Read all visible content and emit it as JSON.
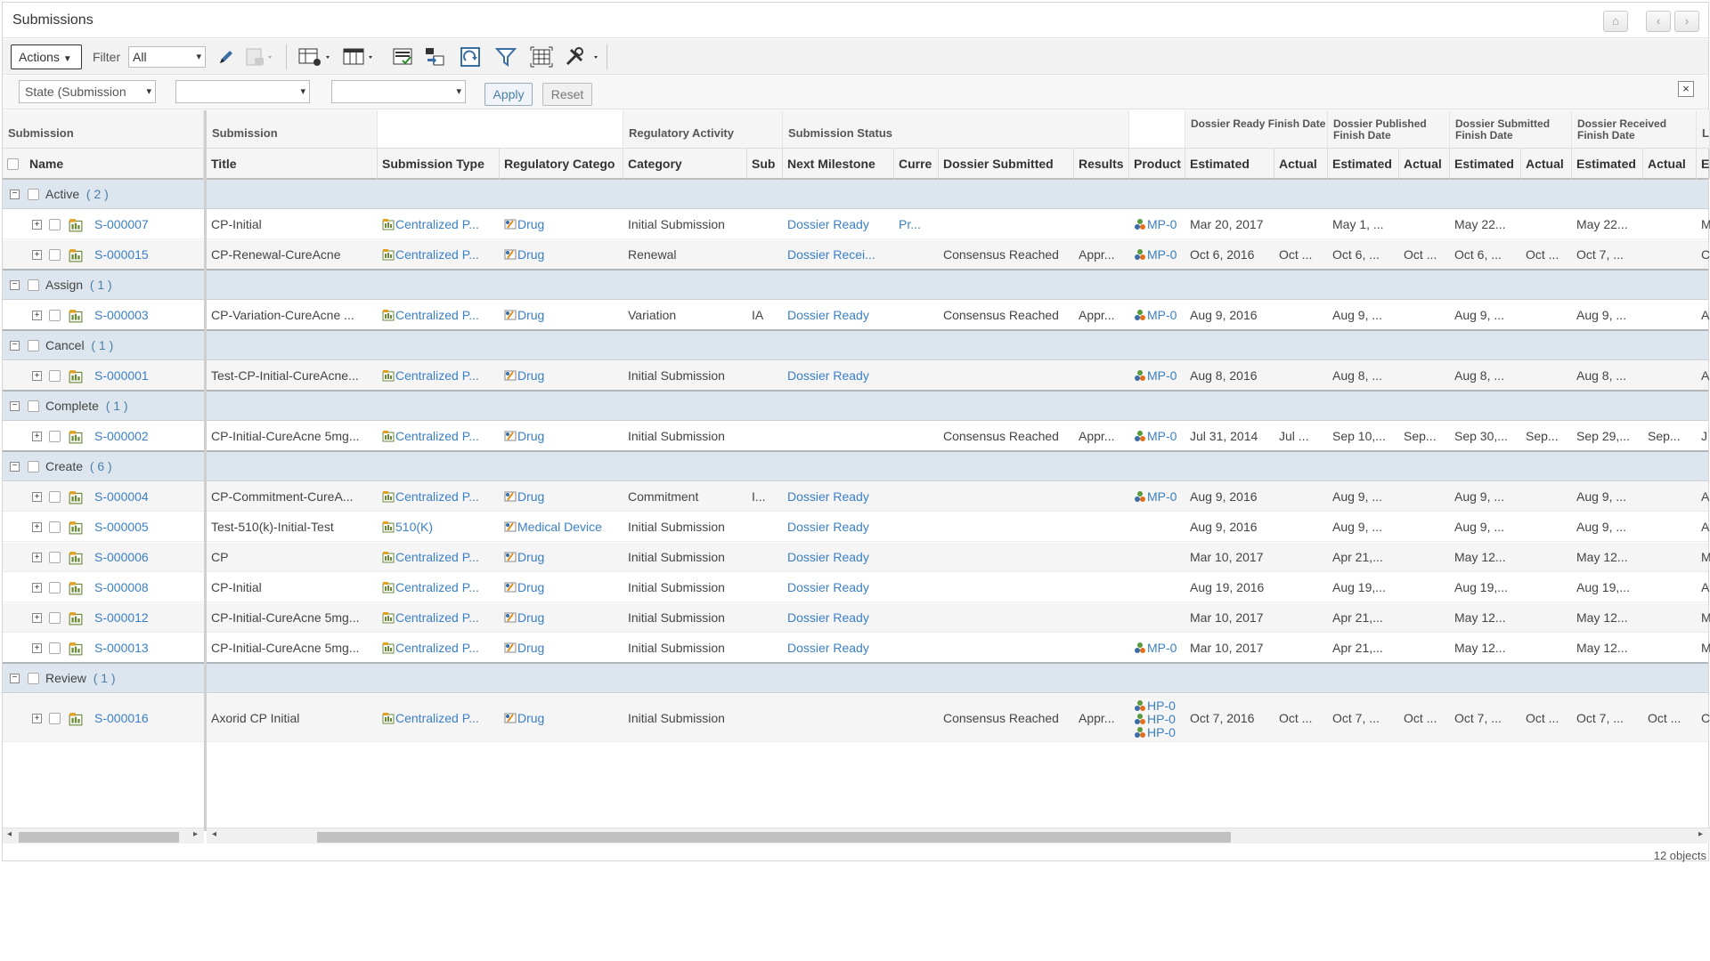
{
  "window": {
    "title": "Submissions"
  },
  "toolbar": {
    "actions_label": "Actions",
    "filter_label": "Filter",
    "filter_value": "All"
  },
  "filterbar": {
    "state_select": "State (Submission",
    "select2": "",
    "select3": "",
    "apply_label": "Apply",
    "reset_label": "Reset"
  },
  "header_groups": {
    "submission1": "Submission",
    "submission2": "Submission",
    "regulatory_activity": "Regulatory Activity",
    "submission_status": "Submission Status",
    "dossier_ready": "Dossier Ready Finish Date",
    "dossier_published": "Dossier Published Finish Date",
    "dossier_submitted": "Dossier Submitted Finish Date",
    "dossier_received": "Dossier Received Finish Date",
    "last": "L"
  },
  "columns": {
    "name": "Name",
    "title": "Title",
    "submission_type": "Submission Type",
    "regulatory_category": "Regulatory Catego",
    "category": "Category",
    "sub": "Sub",
    "next_milestone": "Next Milestone",
    "current": "Curre",
    "dossier_submitted": "Dossier Submitted",
    "results": "Results",
    "product": "Product",
    "estimated1": "Estimated",
    "actual1": "Actual",
    "estimated2": "Estimated",
    "actual2": "Actual",
    "estimated3": "Estimated",
    "actual3": "Actual",
    "estimated4": "Estimated",
    "actual4": "Actual",
    "last": "E"
  },
  "groups": [
    {
      "label": "Active",
      "count": "( 2 )"
    },
    {
      "label": "Assign",
      "count": "( 1 )"
    },
    {
      "label": "Cancel",
      "count": "( 1 )"
    },
    {
      "label": "Complete",
      "count": "( 1 )"
    },
    {
      "label": "Create",
      "count": "( 6 )"
    },
    {
      "label": "Review",
      "count": "( 1 )"
    }
  ],
  "rows": [
    {
      "name": "S-000007",
      "title": "CP-Initial",
      "type": "Centralized P...",
      "regcat": "Drug",
      "category": "Initial Submission",
      "sub": "",
      "next": "Dossier Ready",
      "current": "Pr...",
      "dsub": "",
      "results": "",
      "product": "MP-0",
      "e1": "Mar 20, 2017",
      "a1": "",
      "e2": "May 1, ...",
      "a2": "",
      "e3": "May 22...",
      "a3": "",
      "e4": "May 22...",
      "a4": "",
      "last": "M"
    },
    {
      "name": "S-000015",
      "title": "CP-Renewal-CureAcne",
      "type": "Centralized P...",
      "regcat": "Drug",
      "category": "Renewal",
      "sub": "",
      "next": "Dossier Recei...",
      "current": "",
      "dsub": "Consensus Reached",
      "results": "Appr...",
      "product": "MP-0",
      "e1": "Oct 6, 2016",
      "a1": "Oct ...",
      "e2": "Oct 6, ...",
      "a2": "Oct ...",
      "e3": "Oct 6, ...",
      "a3": "Oct ...",
      "e4": "Oct 7, ...",
      "a4": "",
      "last": "C"
    },
    {
      "name": "S-000003",
      "title": "CP-Variation-CureAcne ...",
      "type": "Centralized P...",
      "regcat": "Drug",
      "category": "Variation",
      "sub": "IA",
      "next": "Dossier Ready",
      "current": "",
      "dsub": "Consensus Reached",
      "results": "Appr...",
      "product": "MP-0",
      "e1": "Aug 9, 2016",
      "a1": "",
      "e2": "Aug 9, ...",
      "a2": "",
      "e3": "Aug 9, ...",
      "a3": "",
      "e4": "Aug 9, ...",
      "a4": "",
      "last": "A"
    },
    {
      "name": "S-000001",
      "title": "Test-CP-Initial-CureAcne...",
      "type": "Centralized P...",
      "regcat": "Drug",
      "category": "Initial Submission",
      "sub": "",
      "next": "Dossier Ready",
      "current": "",
      "dsub": "",
      "results": "",
      "product": "MP-0",
      "e1": "Aug 8, 2016",
      "a1": "",
      "e2": "Aug 8, ...",
      "a2": "",
      "e3": "Aug 8, ...",
      "a3": "",
      "e4": "Aug 8, ...",
      "a4": "",
      "last": "A"
    },
    {
      "name": "S-000002",
      "title": "CP-Initial-CureAcne 5mg...",
      "type": "Centralized P...",
      "regcat": "Drug",
      "category": "Initial Submission",
      "sub": "",
      "next": "",
      "current": "",
      "dsub": "Consensus Reached",
      "results": "Appr...",
      "product": "MP-0",
      "e1": "Jul 31, 2014",
      "a1": "Jul ...",
      "e2": "Sep 10,...",
      "a2": "Sep...",
      "e3": "Sep 30,...",
      "a3": "Sep...",
      "e4": "Sep 29,...",
      "a4": "Sep...",
      "last": "J"
    },
    {
      "name": "S-000004",
      "title": "CP-Commitment-CureA...",
      "type": "Centralized P...",
      "regcat": "Drug",
      "category": "Commitment",
      "sub": "I...",
      "next": "Dossier Ready",
      "current": "",
      "dsub": "",
      "results": "",
      "product": "MP-0",
      "e1": "Aug 9, 2016",
      "a1": "",
      "e2": "Aug 9, ...",
      "a2": "",
      "e3": "Aug 9, ...",
      "a3": "",
      "e4": "Aug 9, ...",
      "a4": "",
      "last": "A"
    },
    {
      "name": "S-000005",
      "title": "Test-510(k)-Initial-Test",
      "type": "510(K)",
      "regcat": "Medical Device",
      "category": "Initial Submission",
      "sub": "",
      "next": "Dossier Ready",
      "current": "",
      "dsub": "",
      "results": "",
      "product": "",
      "e1": "Aug 9, 2016",
      "a1": "",
      "e2": "Aug 9, ...",
      "a2": "",
      "e3": "Aug 9, ...",
      "a3": "",
      "e4": "Aug 9, ...",
      "a4": "",
      "last": "A"
    },
    {
      "name": "S-000006",
      "title": "CP",
      "type": "Centralized P...",
      "regcat": "Drug",
      "category": "Initial Submission",
      "sub": "",
      "next": "Dossier Ready",
      "current": "",
      "dsub": "",
      "results": "",
      "product": "",
      "e1": "Mar 10, 2017",
      "a1": "",
      "e2": "Apr 21,...",
      "a2": "",
      "e3": "May 12...",
      "a3": "",
      "e4": "May 12...",
      "a4": "",
      "last": "M"
    },
    {
      "name": "S-000008",
      "title": "CP-Initial",
      "type": "Centralized P...",
      "regcat": "Drug",
      "category": "Initial Submission",
      "sub": "",
      "next": "Dossier Ready",
      "current": "",
      "dsub": "",
      "results": "",
      "product": "",
      "e1": "Aug 19, 2016",
      "a1": "",
      "e2": "Aug 19,...",
      "a2": "",
      "e3": "Aug 19,...",
      "a3": "",
      "e4": "Aug 19,...",
      "a4": "",
      "last": "A"
    },
    {
      "name": "S-000012",
      "title": "CP-Initial-CureAcne 5mg...",
      "type": "Centralized P...",
      "regcat": "Drug",
      "category": "Initial Submission",
      "sub": "",
      "next": "Dossier Ready",
      "current": "",
      "dsub": "",
      "results": "",
      "product": "",
      "e1": "Mar 10, 2017",
      "a1": "",
      "e2": "Apr 21,...",
      "a2": "",
      "e3": "May 12...",
      "a3": "",
      "e4": "May 12...",
      "a4": "",
      "last": "M"
    },
    {
      "name": "S-000013",
      "title": "CP-Initial-CureAcne 5mg...",
      "type": "Centralized P...",
      "regcat": "Drug",
      "category": "Initial Submission",
      "sub": "",
      "next": "Dossier Ready",
      "current": "",
      "dsub": "",
      "results": "",
      "product": "MP-0",
      "e1": "Mar 10, 2017",
      "a1": "",
      "e2": "Apr 21,...",
      "a2": "",
      "e3": "May 12...",
      "a3": "",
      "e4": "May 12...",
      "a4": "",
      "last": "M"
    },
    {
      "name": "S-000016",
      "title": "Axorid CP Initial",
      "type": "Centralized P...",
      "regcat": "Drug",
      "category": "Initial Submission",
      "sub": "",
      "next": "",
      "current": "",
      "dsub": "Consensus Reached",
      "results": "Appr...",
      "product": "HP-0",
      "e1": "Oct 7, 2016",
      "a1": "Oct ...",
      "e2": "Oct 7, ...",
      "a2": "Oct ...",
      "e3": "Oct 7, ...",
      "a3": "Oct ...",
      "e4": "Oct 7, ...",
      "a4": "Oct ...",
      "last": "C"
    }
  ],
  "review_products": [
    "HP-0",
    "HP-0",
    "HP-0"
  ],
  "status": {
    "count": "12 objects"
  },
  "colors": {
    "link": "#3b7fc4",
    "group_bg": "#dde6ee",
    "header_bg": "#f5f5f5"
  }
}
